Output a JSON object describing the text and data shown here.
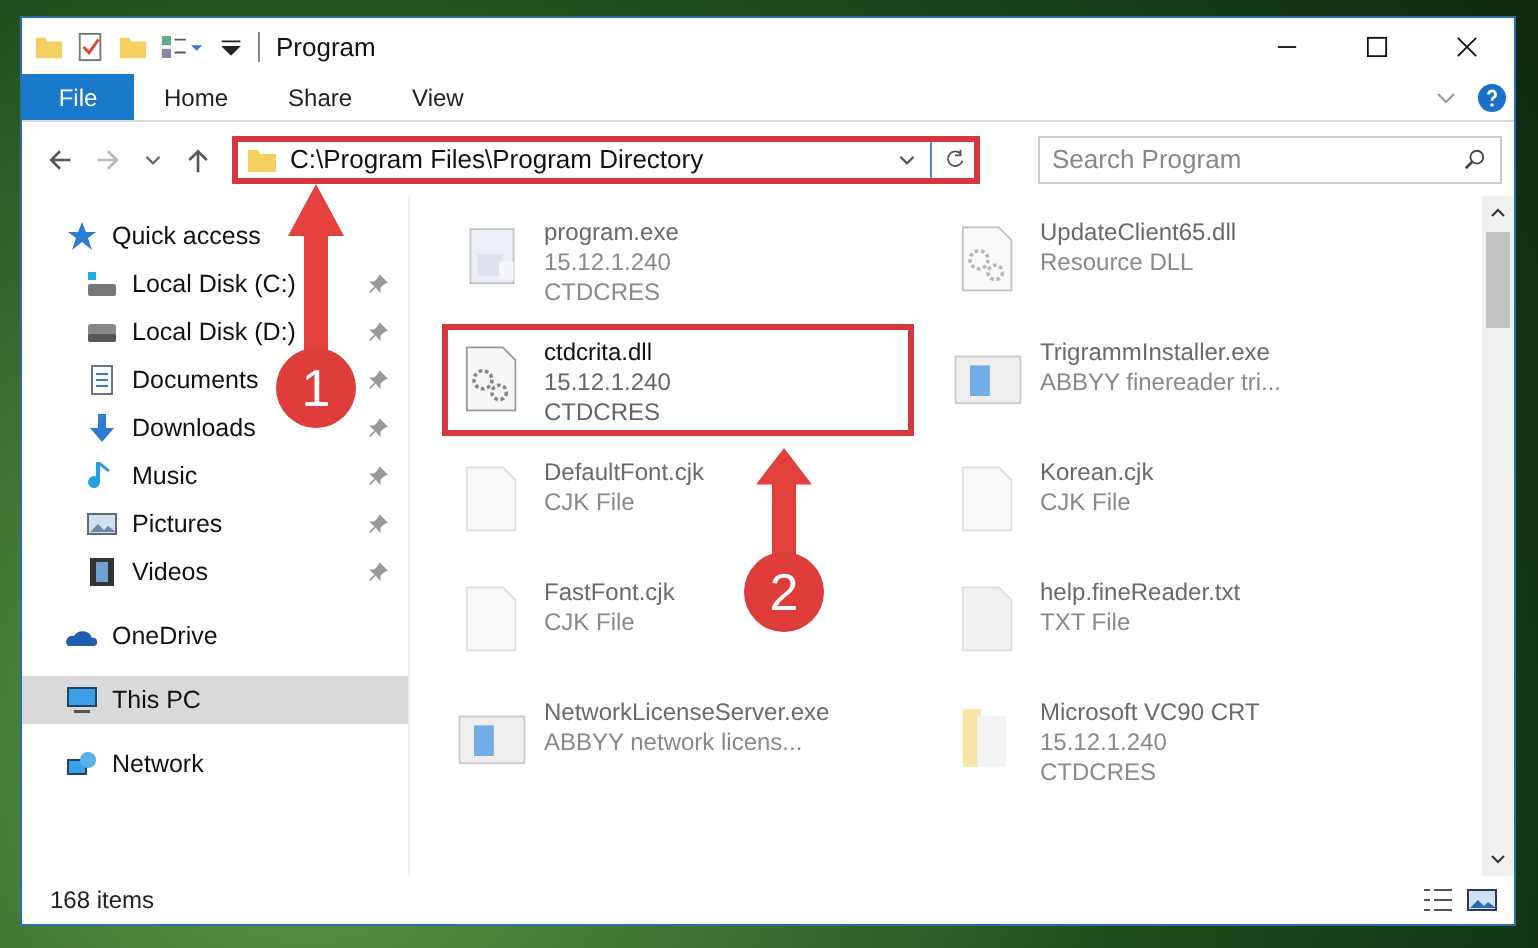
{
  "window": {
    "title": "Program"
  },
  "ribbon": {
    "file_button": "File",
    "tabs": [
      "Home",
      "Share",
      "View"
    ]
  },
  "address": {
    "path": "C:\\Program Files\\Program Directory",
    "highlighted": true
  },
  "search": {
    "placeholder": "Search Program"
  },
  "navigation": [
    {
      "label": "Quick access",
      "kind": "star",
      "selected": false,
      "children": [
        {
          "label": "Local Disk (C:)",
          "kind": "drive-c",
          "pinned": true
        },
        {
          "label": "Local Disk (D:)",
          "kind": "drive",
          "pinned": true
        },
        {
          "label": "Documents",
          "kind": "document",
          "pinned": true
        },
        {
          "label": "Downloads",
          "kind": "download",
          "pinned": true
        },
        {
          "label": "Music",
          "kind": "music",
          "pinned": true
        },
        {
          "label": "Pictures",
          "kind": "picture",
          "pinned": true
        },
        {
          "label": "Videos",
          "kind": "video",
          "pinned": true
        }
      ]
    },
    {
      "label": "OneDrive",
      "kind": "cloud",
      "selected": false
    },
    {
      "label": "This PC",
      "kind": "monitor",
      "selected": true
    },
    {
      "label": "Network",
      "kind": "network",
      "selected": false
    }
  ],
  "files": [
    {
      "name": "program.exe",
      "details": [
        "15.12.1.240",
        "CTDCRES"
      ],
      "kind": "exe",
      "blurred": true,
      "highlighted": false
    },
    {
      "name": "UpdateClient65.dll",
      "details": [
        "Resource DLL"
      ],
      "kind": "dll",
      "blurred": true,
      "highlighted": false
    },
    {
      "name": "ctdcrita.dll",
      "details": [
        "15.12.1.240",
        "CTDCRES"
      ],
      "kind": "dll",
      "blurred": false,
      "highlighted": true
    },
    {
      "name": "TrigrammInstaller.exe",
      "details": [
        "ABBYY finereader tri..."
      ],
      "kind": "window",
      "blurred": true,
      "highlighted": false
    },
    {
      "name": "DefaultFont.cjk",
      "details": [
        "CJK File"
      ],
      "kind": "blank",
      "blurred": true,
      "highlighted": false
    },
    {
      "name": "Korean.cjk",
      "details": [
        "CJK File"
      ],
      "kind": "blank",
      "blurred": true,
      "highlighted": false
    },
    {
      "name": "FastFont.cjk",
      "details": [
        "CJK File"
      ],
      "kind": "blank",
      "blurred": true,
      "highlighted": false
    },
    {
      "name": "help.fineReader.txt",
      "details": [
        "TXT File"
      ],
      "kind": "text",
      "blurred": true,
      "highlighted": false
    },
    {
      "name": "NetworkLicenseServer.exe",
      "details": [
        "ABBYY network licens..."
      ],
      "kind": "window",
      "blurred": true,
      "highlighted": false
    },
    {
      "name": "Microsoft VC90 CRT",
      "details": [
        "15.12.1.240",
        "CTDCRES"
      ],
      "kind": "folder",
      "blurred": true,
      "highlighted": false
    }
  ],
  "status_bar": {
    "item_count": "168 items"
  },
  "callouts": [
    {
      "label": "1"
    },
    {
      "label": "2"
    }
  ]
}
